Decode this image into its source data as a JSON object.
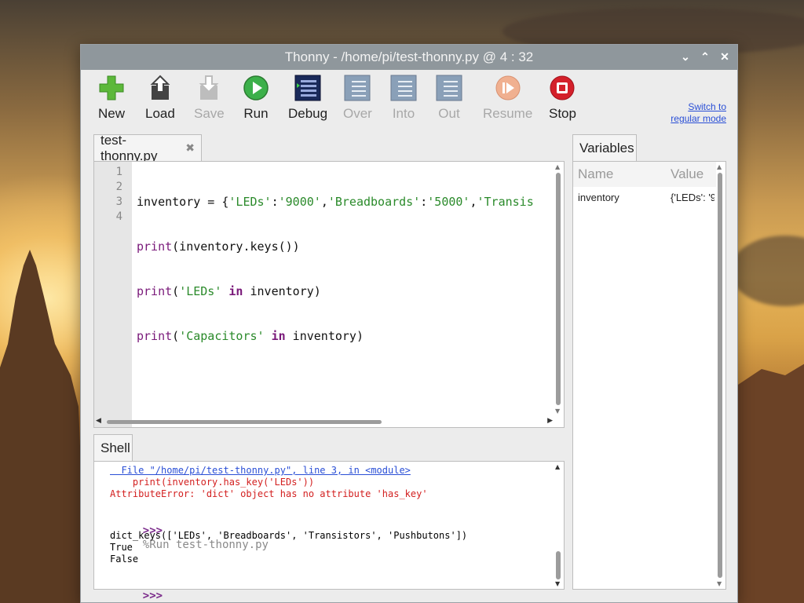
{
  "window": {
    "title": "Thonny  -  /home/pi/test-thonny.py  @  4 : 32"
  },
  "toolbar": {
    "buttons": [
      {
        "label": "New",
        "enabled": true
      },
      {
        "label": "Load",
        "enabled": true
      },
      {
        "label": "Save",
        "enabled": false
      },
      {
        "label": "Run",
        "enabled": true
      },
      {
        "label": "Debug",
        "enabled": true
      },
      {
        "label": "Over",
        "enabled": false
      },
      {
        "label": "Into",
        "enabled": false
      },
      {
        "label": "Out",
        "enabled": false
      },
      {
        "label": "Resume",
        "enabled": false
      },
      {
        "label": "Stop",
        "enabled": true
      }
    ],
    "mode_link_line1": "Switch to",
    "mode_link_line2": "regular mode"
  },
  "editor": {
    "tab_label": "test-thonny.py",
    "line_numbers": [
      "1",
      "2",
      "3",
      "4"
    ],
    "lines": [
      "inventory = {'LEDs':'9000','Breadboards':'5000','Transis",
      "print(inventory.keys())",
      "print('LEDs' in inventory)",
      "print('Capacitors' in inventory)"
    ]
  },
  "shell": {
    "tab_label": "Shell",
    "traceback_file": "  File \"/home/pi/test-thonny.py\", line 3, in <module>",
    "traceback_code": "    print(inventory.has_key('LEDs'))",
    "traceback_error": "AttributeError: 'dict' object has no attribute 'has_key'",
    "prompt": ">>>",
    "run_command": "%Run test-thonny.py",
    "output": [
      "dict_keys(['LEDs', 'Breadboards', 'Transistors', 'Pushbutons'])",
      "True",
      "False"
    ]
  },
  "variables": {
    "tab_label": "Variables",
    "col_name": "Name",
    "col_value": "Value",
    "rows": [
      {
        "name": "inventory",
        "value": "{'LEDs': '9"
      }
    ]
  },
  "colors": {
    "title_bar": "#8f979c",
    "string": "#2a8a2a",
    "keyword": "#7a1a7a",
    "error": "#d32020",
    "link": "#2a4fd6"
  }
}
